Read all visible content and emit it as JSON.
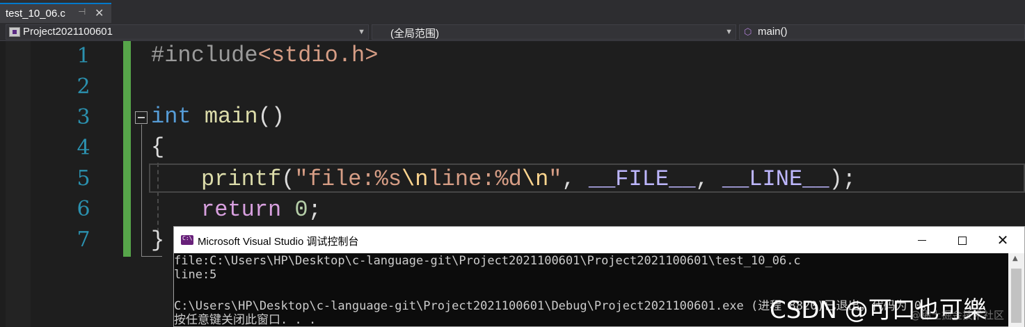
{
  "tab": {
    "filename": "test_10_06.c",
    "pin_glyph": "⊣",
    "close_glyph": "✕"
  },
  "navbar": {
    "project": "Project2021100601",
    "scope": "(全局范围)",
    "member": "main()"
  },
  "editor": {
    "line_numbers": [
      "1",
      "2",
      "3",
      "4",
      "5",
      "6",
      "7"
    ],
    "lines": {
      "l1": {
        "directive": "#include",
        "header": "<stdio.h>"
      },
      "l3": {
        "type": "int",
        "name": "main",
        "parens": "()"
      },
      "l4": {
        "brace": "{"
      },
      "l5": {
        "func": "printf",
        "open": "(",
        "str_a": "\"file:%s",
        "esc_a": "\\n",
        "str_b": "line:%d",
        "esc_b": "\\n",
        "str_c": "\"",
        "sep_a": ", ",
        "macro_a": "__FILE__",
        "sep_b": ", ",
        "macro_b": "__LINE__",
        "close": ");"
      },
      "l6": {
        "kw": "return",
        "num": "0",
        "semi": ";"
      },
      "l7": {
        "brace": "}"
      }
    }
  },
  "console": {
    "title": "Microsoft Visual Studio 调试控制台",
    "output": [
      "file:C:\\Users\\HP\\Desktop\\c-language-git\\Project2021100601\\Project2021100601\\test_10_06.c",
      "line:5",
      "",
      "C:\\Users\\HP\\Desktop\\c-language-git\\Project2021100601\\Debug\\Project2021100601.exe (进程 8820)已退出，代码为 0。",
      "按任意键关闭此窗口. . ."
    ],
    "close_glyph": "✕"
  },
  "watermark": {
    "csdn": "CSDN @可口也可樂",
    "juejin": "@稀土掘金技术社区"
  },
  "colors": {
    "editor_bg": "#1e1e1e",
    "keyword": "#569cd6",
    "function": "#dcdcaa",
    "string": "#d69d85",
    "macro": "#beb7ff",
    "line_number": "#2b91af",
    "change_bar": "#57a64a",
    "accent": "#007acc"
  }
}
